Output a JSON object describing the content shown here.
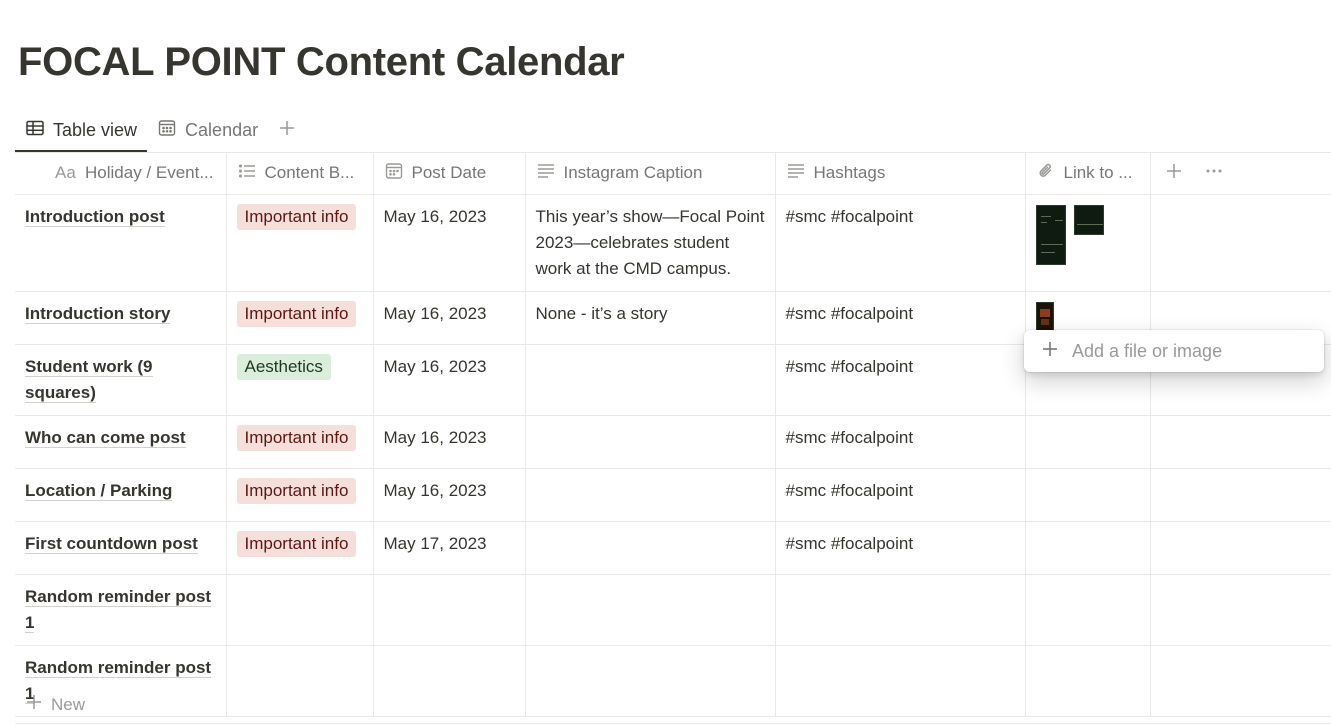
{
  "page": {
    "title": "FOCAL POINT Content Calendar"
  },
  "tabs": [
    {
      "label": "Table view",
      "icon": "table-icon",
      "active": true
    },
    {
      "label": "Calendar",
      "icon": "calendar-icon",
      "active": false
    }
  ],
  "table": {
    "headers": {
      "title": {
        "prefix": "Aa",
        "label": "Holiday / Event..."
      },
      "content_bucket": {
        "label": "Content B...",
        "icon": "list-icon"
      },
      "post_date": {
        "label": "Post Date",
        "icon": "calendar-icon"
      },
      "caption": {
        "label": "Instagram Caption",
        "icon": "text-lines-icon"
      },
      "hashtags": {
        "label": "Hashtags",
        "icon": "text-lines-icon"
      },
      "link": {
        "label": "Link to ...",
        "icon": "paperclip-icon"
      }
    },
    "rows": [
      {
        "title": "Introduction post",
        "tag": "Important info",
        "date": "May 16, 2023",
        "caption": "This year’s show—Focal Point 2023—celebrates student work at the CMD campus.",
        "hashtags": "#smc #focalpoint",
        "files": 2
      },
      {
        "title": "Introduction story",
        "tag": "Important info",
        "date": "May 16, 2023",
        "caption": "None - it’s a story",
        "hashtags": "#smc #focalpoint",
        "files": 1
      },
      {
        "title": "Student work (9 squares)",
        "tag": "Aesthetics",
        "date": "May 16, 2023",
        "caption": "",
        "hashtags": "#smc #focalpoint",
        "files": 0
      },
      {
        "title": "Who can come post",
        "tag": "Important info",
        "date": "May 16, 2023",
        "caption": "",
        "hashtags": "#smc #focalpoint",
        "files": 0
      },
      {
        "title": "Location / Parking",
        "tag": "Important info",
        "date": "May 16, 2023",
        "caption": "",
        "hashtags": "#smc #focalpoint",
        "files": 0
      },
      {
        "title": "First countdown post",
        "tag": "Important info",
        "date": "May 17, 2023",
        "caption": "",
        "hashtags": "#smc #focalpoint",
        "files": 0
      },
      {
        "title": "Random reminder post 1",
        "tag": "",
        "date": "",
        "caption": "",
        "hashtags": "",
        "files": 0
      },
      {
        "title": "Random reminder post 1",
        "tag": "",
        "date": "",
        "caption": "",
        "hashtags": "",
        "files": 0
      }
    ]
  },
  "tag_colors": {
    "Important info": {
      "bg": "#f4dfdb",
      "fg": "#5d1715"
    },
    "Aesthetics": {
      "bg": "#dbeddb",
      "fg": "#1c3829"
    }
  },
  "new_row_label": "New",
  "popover": {
    "label": "Add a file or image"
  }
}
